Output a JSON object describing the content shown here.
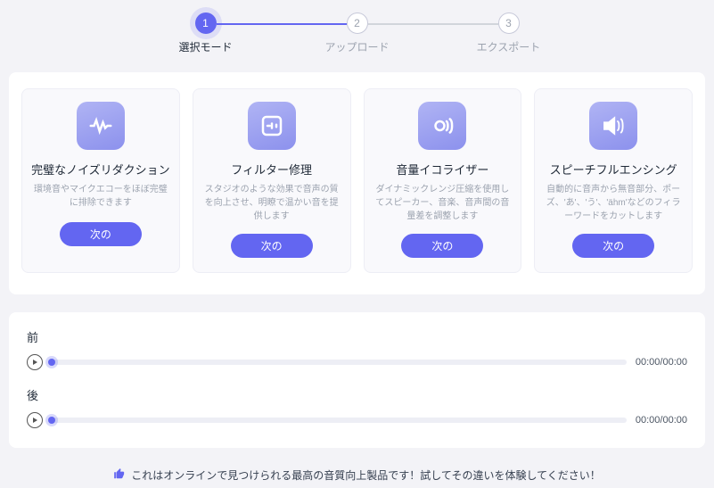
{
  "stepper": {
    "steps": [
      {
        "num": "1",
        "label": "選択モード",
        "active": true
      },
      {
        "num": "2",
        "label": "アップロード",
        "active": false
      },
      {
        "num": "3",
        "label": "エクスポート",
        "active": false
      }
    ]
  },
  "cards": [
    {
      "icon": "waveform-icon",
      "title": "完璧なノイズリダクション",
      "desc": "環境音やマイクエコーをほぼ完璧に排除できます",
      "button": "次の"
    },
    {
      "icon": "filter-icon",
      "title": "フィルター修理",
      "desc": "スタジオのような効果で音声の質を向上させ、明瞭で温かい音を提供します",
      "button": "次の"
    },
    {
      "icon": "equalizer-icon",
      "title": "音量イコライザー",
      "desc": "ダイナミックレンジ圧縮を使用してスピーカー、音楽、音声間の音量差を調整します",
      "button": "次の"
    },
    {
      "icon": "speaker-icon",
      "title": "スピーチフルエンシング",
      "desc": "自動的に音声から無音部分、ポーズ、'あ'、'う'、'ähm'などのフィラーワードをカットします",
      "button": "次の"
    }
  ],
  "audio": {
    "before": {
      "label": "前",
      "time": "00:00/00:00"
    },
    "after": {
      "label": "後",
      "time": "00:00/00:00"
    }
  },
  "footer": {
    "text": "これはオンラインで見つけられる最高の音質向上製品です！試してその違いを体験してください！"
  }
}
